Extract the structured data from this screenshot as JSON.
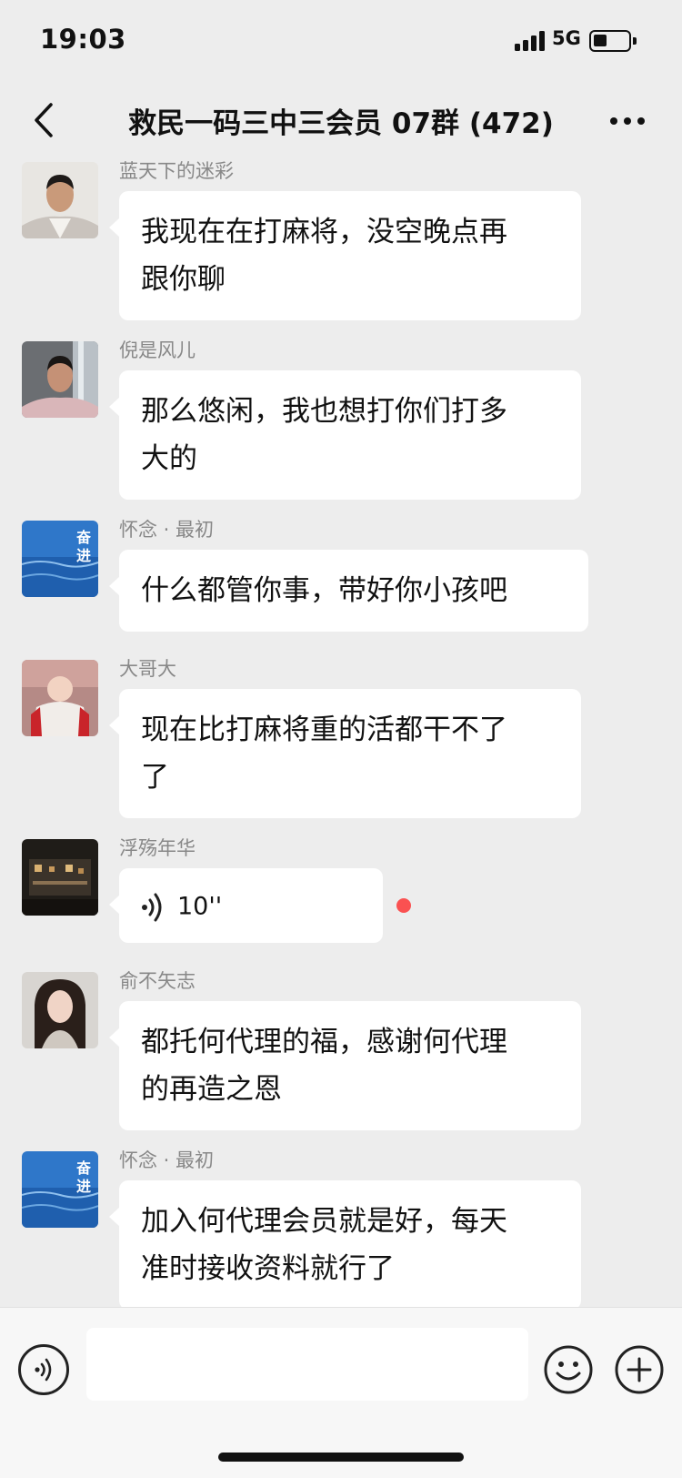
{
  "status_bar": {
    "time": "19:03",
    "network": "5G",
    "battery_level": 0.4
  },
  "nav": {
    "title": "救民一码三中三会员 07群 (472)"
  },
  "messages": [
    {
      "sender": "蓝天下的迷彩",
      "lines": [
        "我现在在打麻将，没空晚点再",
        "跟你聊"
      ],
      "avatar": "man-portrait"
    },
    {
      "sender": "倪是风儿",
      "lines": [
        "那么悠闲，我也想打你们打多",
        "大的"
      ],
      "avatar": "man-portrait-waterfall"
    },
    {
      "sender": "怀念 · 最初",
      "lines": [
        "什么都管你事，带好你小孩吧"
      ],
      "avatar": "ocean-poster"
    },
    {
      "sender": "大哥大",
      "lines": [
        "现在比打麻将重的活都干不了",
        "了"
      ],
      "avatar": "baby-photo"
    },
    {
      "sender": "浮殇年华",
      "voice_duration": "10''",
      "unread": true,
      "avatar": "night-scene"
    },
    {
      "sender": "俞不矢志",
      "lines": [
        "都托何代理的福，感谢何代理",
        "的再造之恩"
      ],
      "avatar": "woman-portrait"
    },
    {
      "sender": "怀念 · 最初",
      "lines": [
        "加入何代理会员就是好，每天",
        "准时接收资料就行了"
      ],
      "avatar": "ocean-poster"
    }
  ],
  "poster_text": {
    "big_char_1": "奋",
    "big_char_2": "进"
  },
  "input_bar": {
    "placeholder": ""
  },
  "colors": {
    "background": "#ededed",
    "bubble": "#ffffff",
    "unread_dot": "#fa5151"
  }
}
